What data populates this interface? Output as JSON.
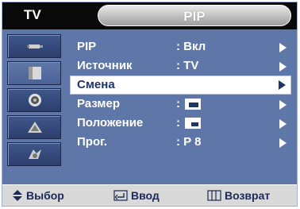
{
  "header": {
    "source_label": "TV",
    "menu_title": "PIP"
  },
  "sidebar": {
    "icons": [
      {
        "name": "antenna-icon",
        "active": false
      },
      {
        "name": "picture-icon",
        "active": true
      },
      {
        "name": "sound-icon",
        "active": false
      },
      {
        "name": "channel-icon",
        "active": false
      },
      {
        "name": "setup-icon",
        "active": false
      }
    ]
  },
  "menu": {
    "rows": [
      {
        "label": "PIP",
        "value": ": Вкл"
      },
      {
        "label": "Источник",
        "value": ": TV"
      },
      {
        "label": "Смена",
        "value": ""
      },
      {
        "label": "Размер",
        "value": ":"
      },
      {
        "label": "Положение",
        "value": ":"
      },
      {
        "label": "Прог.",
        "value": ": P 8"
      }
    ],
    "selected_index": 2
  },
  "footer": {
    "select_label": "Выбор",
    "enter_label": "Ввод",
    "return_label": "Возврат"
  },
  "colors": {
    "panel": "#5f77a8",
    "header": "#0a0a0a",
    "footer": "#d9d9d9",
    "highlight": "#ffffff",
    "text_dark": "#203566"
  }
}
